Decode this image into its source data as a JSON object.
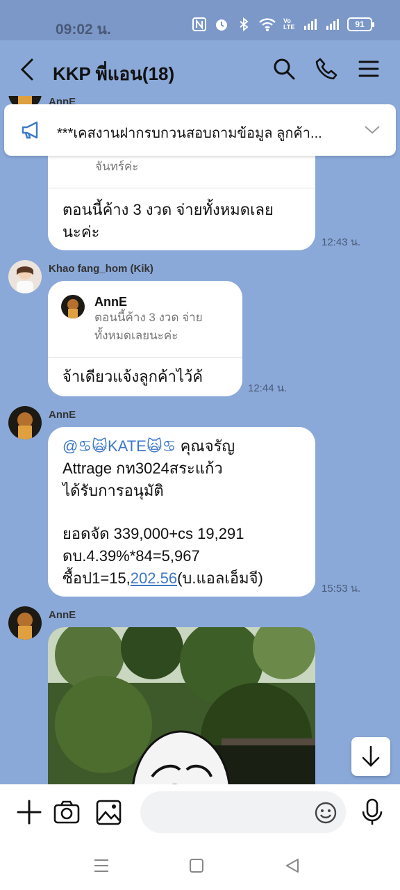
{
  "status": {
    "time": "09:02 น.",
    "battery": "91",
    "volte": "Vo LTE"
  },
  "header": {
    "title": "KKP พี่แอน(18)"
  },
  "announcement": {
    "text": "***เคสงานฝากรบกวนสอบถามข้อมูล ลูกค้า..."
  },
  "messages": {
    "m1": {
      "sender": "AnnE",
      "quote_tail": "จันทร์ค่ะ",
      "line1": "ตอนนี้ค้าง 3 งวด จ่ายทั้งหมดเลย",
      "line2": "นะค่ะ",
      "time": "12:43 น."
    },
    "m2": {
      "sender": "Khao fang_hom (Kik)",
      "quote_name": "AnnE",
      "quote_line1": "ตอนนี้ค้าง 3 งวด จ่าย",
      "quote_line2": "ทั้งหมดเลยนะค่ะ",
      "text": "จ้าเดียวแจ้งลูกค้าไว้ค้",
      "time": "12:44 น."
    },
    "m3": {
      "sender": "AnnE",
      "mention": "@♋🙀KATE🙀♋",
      "l1_rest": "  คุณจรัญ",
      "l2": "Attrage กท3024สระแก้ว",
      "l3": "ได้รับการอนุมัติ",
      "l4": "ยอดจัด 339,000+cs 19,291",
      "l5": "ดบ.4.39%*84=5,967",
      "l6_pre": "ซื้อป1=15,",
      "l6_link": "202.56",
      "l6_post": "(บ.แอลเอ็มจี)",
      "time": "15:53 น."
    },
    "m4": {
      "sender": "AnnE"
    }
  },
  "icons": {
    "back": "back-arrow-icon",
    "search": "search-icon",
    "call": "phone-icon",
    "menu": "menu-icon",
    "megaphone": "megaphone-icon",
    "chevron": "chevron-down-icon",
    "plus": "plus-icon",
    "camera": "camera-icon",
    "image": "image-icon",
    "emoji": "emoji-icon",
    "mic": "microphone-icon",
    "scroll_down": "arrow-down-icon"
  }
}
